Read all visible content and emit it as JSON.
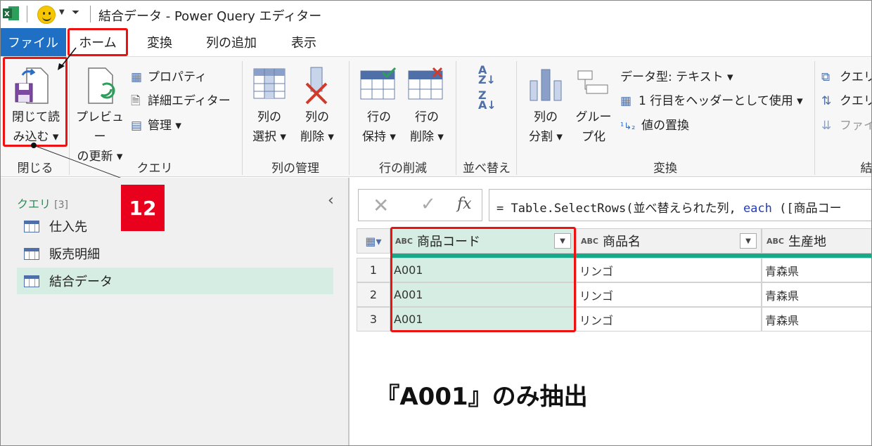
{
  "window": {
    "title": "結合データ - Power Query エディター"
  },
  "tabs": [
    {
      "label": "ファイル"
    },
    {
      "label": "ホーム"
    },
    {
      "label": "変換"
    },
    {
      "label": "列の追加"
    },
    {
      "label": "表示"
    }
  ],
  "ribbon": {
    "close_load": {
      "line1": "閉じて読",
      "line2": "み込む ▾"
    },
    "preview_refresh": {
      "line1": "プレビュー",
      "line2": "の更新 ▾"
    },
    "properties": "プロパティ",
    "advanced_editor": "詳細エディター",
    "manage": "管理 ▾",
    "choose_columns": {
      "line1": "列の",
      "line2": "選択 ▾"
    },
    "remove_columns": {
      "line1": "列の",
      "line2": "削除 ▾"
    },
    "keep_rows": {
      "line1": "行の",
      "line2": "保持 ▾"
    },
    "remove_rows": {
      "line1": "行の",
      "line2": "削除 ▾"
    },
    "split_column": {
      "line1": "列の",
      "line2": "分割 ▾"
    },
    "group_by": {
      "line1": "グルー",
      "line2": "プ化"
    },
    "data_type": "データ型: テキスト ▾",
    "first_row_header": "1 行目をヘッダーとして使用 ▾",
    "replace_values": "値の置換",
    "query_1": "クエリ",
    "query_2": "クエリ",
    "file": "ファイ",
    "group_labels": {
      "close": "閉じる",
      "query": "クエリ",
      "manage_columns": "列の管理",
      "reduce_rows": "行の削減",
      "sort": "並べ替え",
      "transform": "変換",
      "combine": "結"
    }
  },
  "queries": {
    "title": "クエリ",
    "count": "[3]",
    "items": [
      {
        "label": "仕入先"
      },
      {
        "label": "販売明細"
      },
      {
        "label": "結合データ"
      }
    ]
  },
  "step_badge": "12",
  "formula_bar": {
    "prefix": "= Table.SelectRows(並べ替えられた列, ",
    "keyword": "each",
    "suffix": " ([商品コー"
  },
  "grid": {
    "type_label": "ABC",
    "columns": [
      {
        "name": "商品コード"
      },
      {
        "name": "商品名"
      },
      {
        "name": "生産地"
      }
    ],
    "rows": [
      {
        "num": "1",
        "cells": [
          "A001",
          "リンゴ",
          "青森県"
        ]
      },
      {
        "num": "2",
        "cells": [
          "A001",
          "リンゴ",
          "青森県"
        ]
      },
      {
        "num": "3",
        "cells": [
          "A001",
          "リンゴ",
          "青森県"
        ]
      }
    ]
  },
  "caption": "『A001』のみ抽出",
  "colors": {
    "accent_red": "#e11111",
    "file_tab": "#1f6fc5",
    "teal": "#18a98b",
    "selected_green": "#d6ede3"
  }
}
